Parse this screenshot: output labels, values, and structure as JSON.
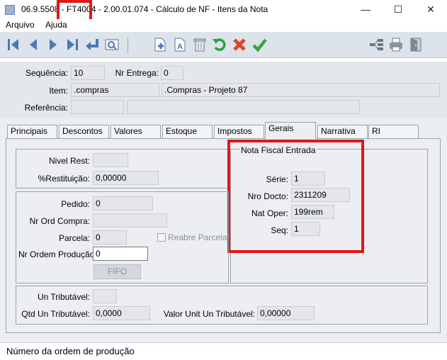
{
  "window": {
    "title": "06.9.5508 - FT4004 - 2.00.01.074 - Cálculo de NF - Itens da Nota",
    "minimize": "—",
    "maximize": "☐",
    "close": "✕"
  },
  "menu": {
    "items": [
      "Arquivo",
      "Ajuda"
    ]
  },
  "toolbar": {
    "icons": [
      "first-record",
      "previous-record",
      "next-record",
      "last-record",
      "return",
      "search",
      "new-document",
      "edit-document",
      "delete",
      "undo",
      "cancel",
      "confirm",
      "tree-list",
      "print",
      "exit"
    ]
  },
  "header": {
    "sequencia_label": "Sequência:",
    "sequencia_value": "10",
    "nr_entrega_label": "Nr Entrega:",
    "nr_entrega_value": "0",
    "item_label": "Item:",
    "item_code": ".compras",
    "item_description": ".Compras - Projeto 87",
    "referencia_label": "Referência:",
    "referencia_code": "",
    "referencia_description": ""
  },
  "tabs": [
    "Principais",
    "Descontos",
    "Valores",
    "Estoque",
    "Impostos",
    "Gerais",
    "Narrativa",
    "RI"
  ],
  "active_tab": "Gerais",
  "gerais": {
    "nivel_rest_label": "Nivel Rest:",
    "nivel_rest_value": "",
    "restituicao_label": "%Restituição:",
    "restituicao_value": "0,00000",
    "pedido_label": "Pedido:",
    "pedido_value": "0",
    "nr_ord_compra_label": "Nr Ord Compra:",
    "nr_ord_compra_value": "",
    "parcela_label": "Parcela:",
    "parcela_value": "0",
    "reabre_parcela_label": "Reabre Parcela",
    "nr_ordem_producao_label": "Nr Ordem Produção:",
    "nr_ordem_producao_value": "0",
    "fifo_label": "FIFO",
    "nota_fiscal_title": "Nota Fiscal Entrada",
    "serie_label": "Série:",
    "serie_value": "1",
    "nro_docto_label": "Nro Docto:",
    "nro_docto_value": "2311209",
    "nat_oper_label": "Nat Oper:",
    "nat_oper_value": "199rem",
    "seq_label": "Seq:",
    "seq_value": "1",
    "un_tributavel_label": "Un Tributável:",
    "un_tributavel_value": "",
    "qtd_un_tributavel_label": "Qtd Un Tributável:",
    "qtd_un_tributavel_value": "0,0000",
    "valor_unit_label": "Valor Unit Un Tributável:",
    "valor_unit_value": "0,00000"
  },
  "status": {
    "text": "Número da ordem de produção"
  },
  "colors": {
    "highlight": "#e01818",
    "toolbar_bg": "#dde3eb",
    "panel_bg": "#eceef2"
  }
}
